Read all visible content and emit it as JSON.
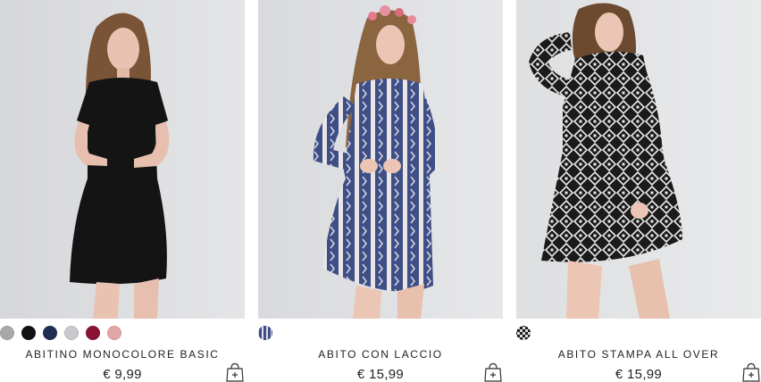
{
  "products": [
    {
      "name": "ABITINO MONOCOLORE BASIC",
      "price": "€ 9,99",
      "swatches": [
        "#a8a8a8",
        "#111111",
        "#1f2d52",
        "#c9c9cd",
        "#8a1232",
        "#e3a6a6"
      ],
      "image_icon": "product-photo",
      "cart_icon": "shopping-bag-add-icon"
    },
    {
      "name": "ABITO CON LACCIO",
      "price": "€ 15,99",
      "swatches": [
        "pattern-blue"
      ],
      "image_icon": "product-photo",
      "cart_icon": "shopping-bag-add-icon"
    },
    {
      "name": "ABITO STAMPA ALL OVER",
      "price": "€ 15,99",
      "swatches": [
        "pattern-black-white"
      ],
      "image_icon": "product-photo",
      "cart_icon": "shopping-bag-add-icon"
    }
  ]
}
